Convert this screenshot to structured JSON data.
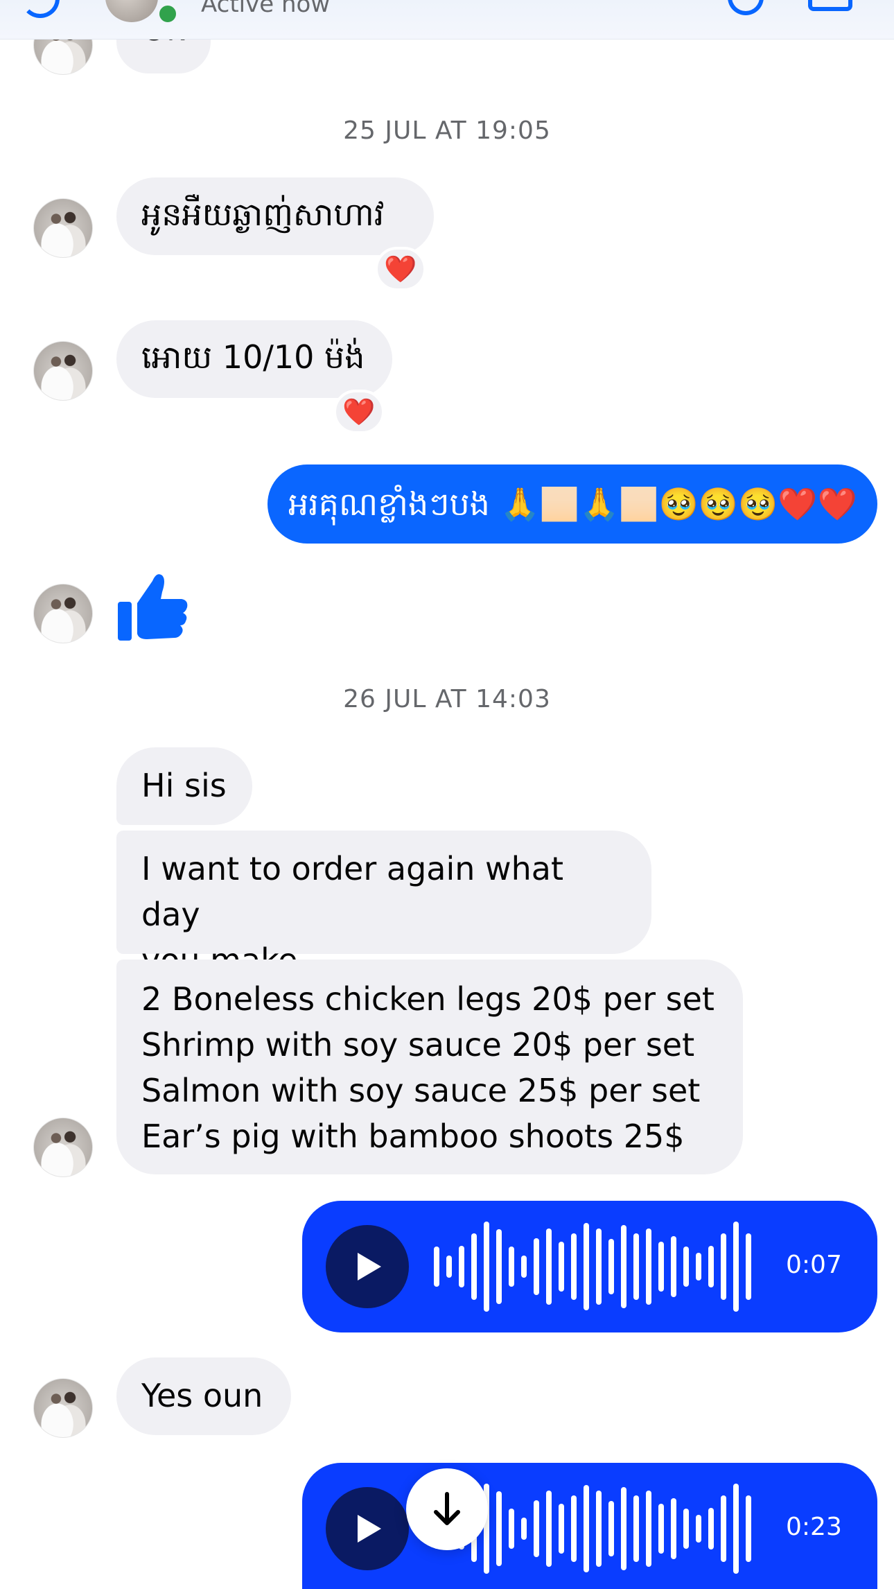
{
  "header": {
    "status": "Active now"
  },
  "messages": {
    "partial_first": "Ok",
    "ts1": "25 JUL AT 19:05",
    "in1": "អូនអឺយឆ្ងាញ់សាហាវ",
    "in1_reaction": "❤️",
    "in2": "អោយ 10/10 ម៉ង់",
    "in2_reaction": "❤️",
    "out1": "អរគុណខ្លាំងៗបង 🙏🏻🙏🏻🥹🥹🥹❤️❤️",
    "ts2": "26 JUL AT 14:03",
    "in3": "Hi sis",
    "in4_line1": "I want to order again what day",
    "in4_line2": "you make",
    "in5_line1": "2 Boneless chicken legs 20$ per set",
    "in5_line2": "Shrimp with soy sauce 20$ per set",
    "in5_line3": "Salmon with soy sauce 25$ per set",
    "in5_line4": "Ear’s pig with bamboo shoots 25$",
    "audio1_duration": "0:07",
    "in6": "Yes oun",
    "audio2_duration": "0:23"
  },
  "colors": {
    "brand": "#0866ff",
    "outgoing_bubble": "#0a66ff",
    "audio_bubble": "#0a3dff",
    "incoming_bubble": "#f0f0f4",
    "timestamp": "#65676b",
    "online": "#31a24c"
  },
  "icons": [
    "back-arrow-icon",
    "phone-icon",
    "video-icon",
    "thumbs-up-icon",
    "play-icon",
    "arrow-down-icon",
    "heart-icon"
  ]
}
